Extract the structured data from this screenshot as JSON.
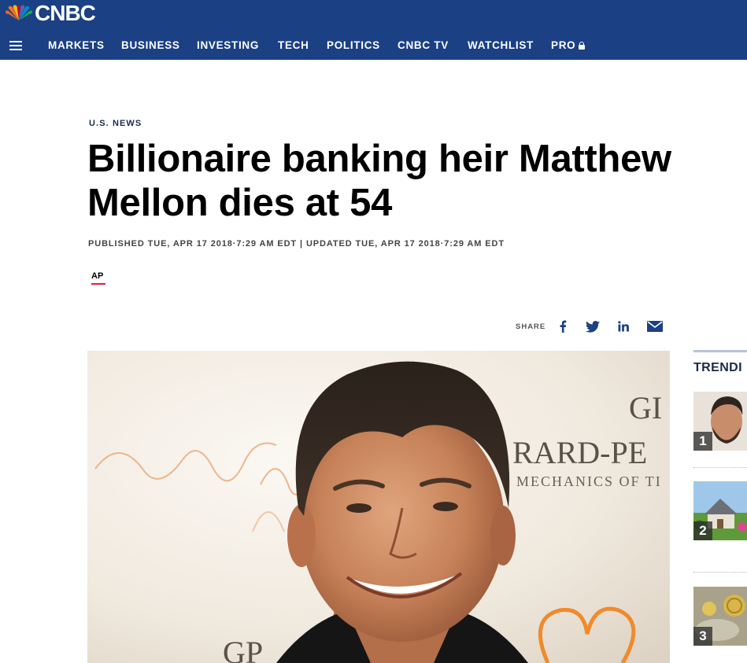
{
  "header": {
    "logo_text": "CNBC",
    "logo_icon": "nbc-peacock-icon",
    "menu_icon": "hamburger-menu-icon",
    "nav": [
      {
        "label": "MARKETS"
      },
      {
        "label": "BUSINESS"
      },
      {
        "label": "INVESTING"
      },
      {
        "label": "TECH"
      },
      {
        "label": "POLITICS"
      },
      {
        "label": "CNBC TV"
      },
      {
        "label": "WATCHLIST"
      },
      {
        "label": "PRO",
        "icon": "lock-icon"
      }
    ],
    "background_color": "#1b4083"
  },
  "article": {
    "section": "U.S. NEWS",
    "headline": "Billionaire banking heir Matthew Mellon dies at 54",
    "dateline": "PUBLISHED TUE, APR 17 2018·7:29 AM EDT | UPDATED TUE, APR 17 2018·7:29 AM EDT",
    "source": "AP",
    "source_accent_color": "#e31c3d"
  },
  "share": {
    "label": "SHARE",
    "icons": [
      "facebook-icon",
      "twitter-icon",
      "linkedin-icon",
      "email-icon"
    ],
    "icon_color": "#1b4083"
  },
  "hero_image": {
    "backdrop_text_1": "GI",
    "backdrop_text_2": "RARD-PE",
    "backdrop_text_3": "MECHANICS OF TI",
    "backdrop_text_4": "GP"
  },
  "trending": {
    "title": "TRENDI",
    "items": [
      {
        "rank": "1"
      },
      {
        "rank": "2"
      },
      {
        "rank": "3"
      }
    ]
  }
}
